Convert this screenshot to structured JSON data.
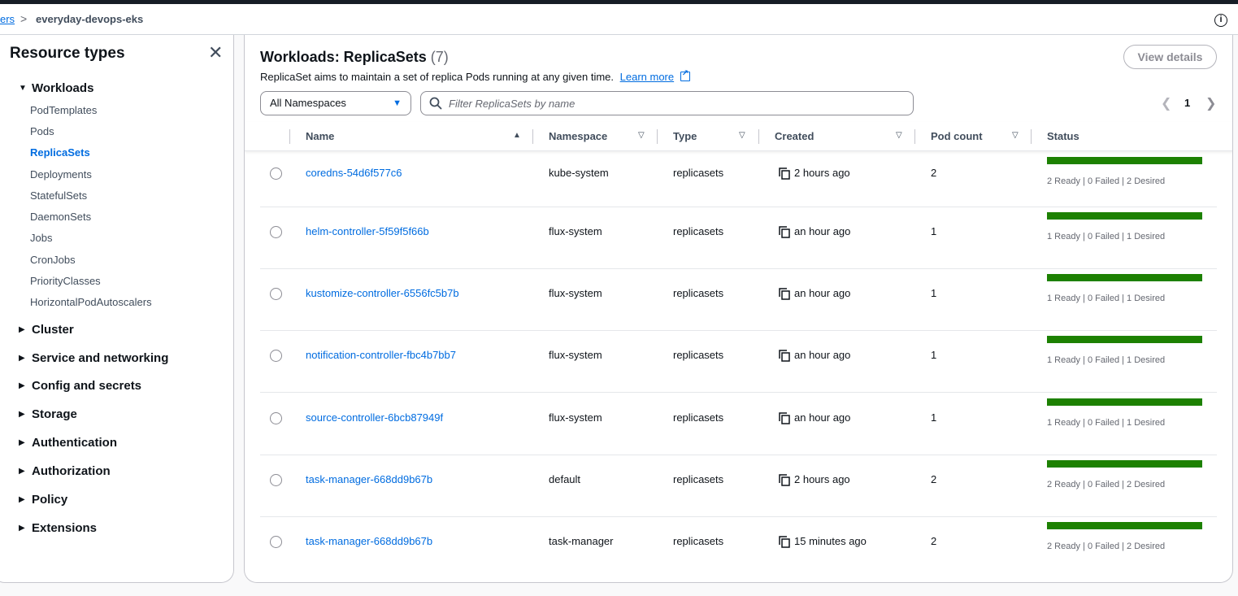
{
  "breadcrumb": {
    "parent": "ers",
    "separator": ">",
    "current": "everyday-devops-eks"
  },
  "sidebar": {
    "title": "Resource types",
    "workloads": {
      "label": "Workloads",
      "items": [
        "PodTemplates",
        "Pods",
        "ReplicaSets",
        "Deployments",
        "StatefulSets",
        "DaemonSets",
        "Jobs",
        "CronJobs",
        "PriorityClasses",
        "HorizontalPodAutoscalers"
      ],
      "active": "ReplicaSets"
    },
    "groups": [
      "Cluster",
      "Service and networking",
      "Config and secrets",
      "Storage",
      "Authentication",
      "Authorization",
      "Policy",
      "Extensions"
    ]
  },
  "main": {
    "title": "Workloads: ReplicaSets",
    "count": "(7)",
    "description": "ReplicaSet aims to maintain a set of replica Pods running at any given time.",
    "learn_more": "Learn more",
    "view_details": "View details",
    "namespace_select": "All Namespaces",
    "filter_placeholder": "Filter ReplicaSets by name",
    "page": "1"
  },
  "table": {
    "columns": [
      "Name",
      "Namespace",
      "Type",
      "Created",
      "Pod count",
      "Status"
    ],
    "rows": [
      {
        "name": "coredns-54d6f577c6",
        "namespace": "kube-system",
        "type": "replicasets",
        "created": "2 hours ago",
        "pods": "2",
        "status": "2 Ready | 0 Failed | 2 Desired"
      },
      {
        "name": "helm-controller-5f59f5f66b",
        "namespace": "flux-system",
        "type": "replicasets",
        "created": "an hour ago",
        "pods": "1",
        "status": "1 Ready | 0 Failed | 1 Desired"
      },
      {
        "name": "kustomize-controller-6556fc5b7b",
        "namespace": "flux-system",
        "type": "replicasets",
        "created": "an hour ago",
        "pods": "1",
        "status": "1 Ready | 0 Failed | 1 Desired"
      },
      {
        "name": "notification-controller-fbc4b7bb7",
        "namespace": "flux-system",
        "type": "replicasets",
        "created": "an hour ago",
        "pods": "1",
        "status": "1 Ready | 0 Failed | 1 Desired"
      },
      {
        "name": "source-controller-6bcb87949f",
        "namespace": "flux-system",
        "type": "replicasets",
        "created": "an hour ago",
        "pods": "1",
        "status": "1 Ready | 0 Failed | 1 Desired"
      },
      {
        "name": "task-manager-668dd9b67b",
        "namespace": "default",
        "type": "replicasets",
        "created": "2 hours ago",
        "pods": "2",
        "status": "2 Ready | 0 Failed | 2 Desired"
      },
      {
        "name": "task-manager-668dd9b67b",
        "namespace": "task-manager",
        "type": "replicasets",
        "created": "15 minutes ago",
        "pods": "2",
        "status": "2 Ready | 0 Failed | 2 Desired"
      }
    ]
  },
  "colors": {
    "link": "#006ce0",
    "status_ready": "#1d8102",
    "border": "#c6c6cd"
  },
  "icons": [
    "info-icon",
    "close-icon",
    "external-link-icon",
    "search-icon",
    "copy-icon",
    "sort-icon",
    "caret-right-icon",
    "caret-down-icon"
  ]
}
